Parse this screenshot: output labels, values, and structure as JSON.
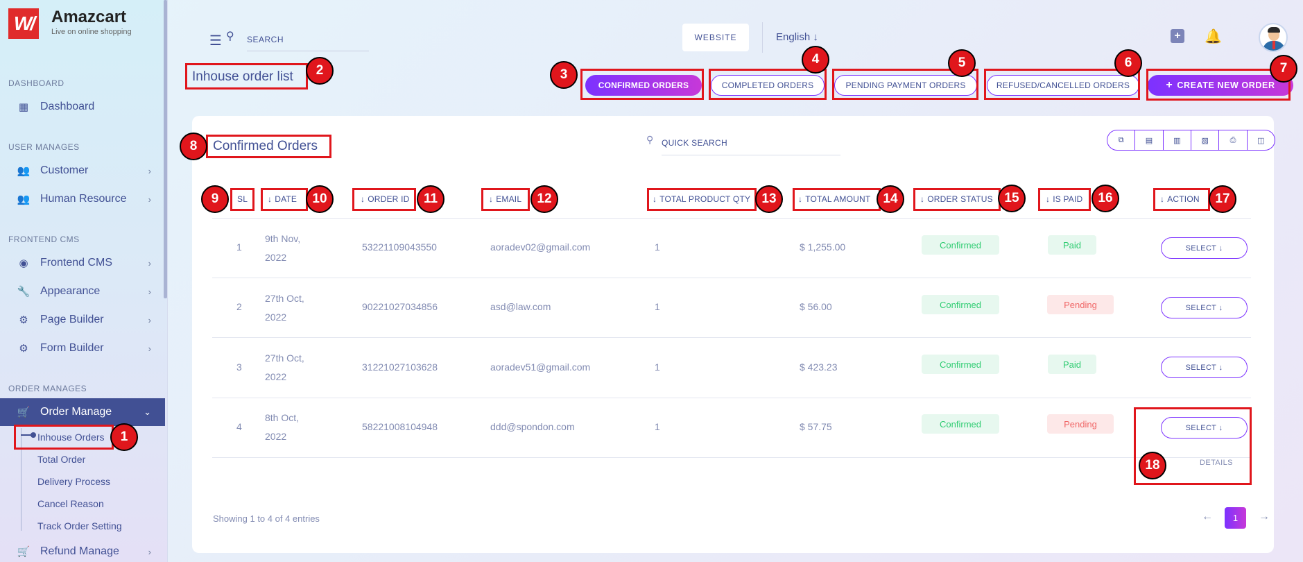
{
  "app": {
    "brand_name": "Amazcart",
    "brand_tagline": "Live on online shopping",
    "logo_text": "W/"
  },
  "sidebar": {
    "sections": [
      "DASHBOARD",
      "USER MANAGES",
      "FRONTEND CMS",
      "ORDER MANAGES"
    ],
    "items": [
      {
        "label": "Dashboard",
        "icon": "grid-icon"
      },
      {
        "label": "Customer",
        "icon": "users-icon"
      },
      {
        "label": "Human Resource",
        "icon": "users-icon"
      },
      {
        "label": "Frontend CMS",
        "icon": "eye-icon"
      },
      {
        "label": "Appearance",
        "icon": "wrench-icon"
      },
      {
        "label": "Page Builder",
        "icon": "gears-icon"
      },
      {
        "label": "Form Builder",
        "icon": "gears-icon"
      },
      {
        "label": "Order Manage",
        "icon": "cart-icon"
      },
      {
        "label": "Refund Manage",
        "icon": "cart-icon"
      }
    ],
    "sub_items": [
      "Inhouse Orders",
      "Total Order",
      "Delivery Process",
      "Cancel Reason",
      "Track Order Setting"
    ]
  },
  "topbar": {
    "search_placeholder": "SEARCH",
    "website_label": "WEBSITE",
    "language": "English"
  },
  "page": {
    "title": "Inhouse order list",
    "tabs": [
      "CONFIRMED ORDERS",
      "COMPLETED ORDERS",
      "PENDING PAYMENT ORDERS",
      "REFUSED/CANCELLED ORDERS"
    ],
    "create_label": "CREATE NEW ORDER"
  },
  "card": {
    "title": "Confirmed Orders",
    "quick_search_placeholder": "QUICK SEARCH",
    "export_icons": [
      "copy-icon",
      "excel-icon",
      "csv-icon",
      "pdf-icon",
      "print-icon",
      "columns-icon"
    ]
  },
  "table": {
    "headers": [
      "SL",
      "DATE",
      "ORDER ID",
      "EMAIL",
      "TOTAL PRODUCT QTY",
      "TOTAL AMOUNT",
      "ORDER STATUS",
      "IS PAID",
      "ACTION"
    ],
    "rows": [
      {
        "sl": "1",
        "date1": "9th Nov,",
        "date2": "2022",
        "order_id": "53221109043550",
        "email": "aoradev02@gmail.com",
        "qty": "1",
        "amount": "$ 1,255.00",
        "status": "Confirmed",
        "paid": "Paid",
        "action": "SELECT"
      },
      {
        "sl": "2",
        "date1": "27th Oct,",
        "date2": "2022",
        "order_id": "90221027034856",
        "email": "asd@law.com",
        "qty": "1",
        "amount": "$ 56.00",
        "status": "Confirmed",
        "paid": "Pending",
        "action": "SELECT"
      },
      {
        "sl": "3",
        "date1": "27th Oct,",
        "date2": "2022",
        "order_id": "31221027103628",
        "email": "aoradev51@gmail.com",
        "qty": "1",
        "amount": "$ 423.23",
        "status": "Confirmed",
        "paid": "Paid",
        "action": "SELECT"
      },
      {
        "sl": "4",
        "date1": "8th Oct,",
        "date2": "2022",
        "order_id": "58221008104948",
        "email": "ddd@spondon.com",
        "qty": "1",
        "amount": "$ 57.75",
        "status": "Confirmed",
        "paid": "Pending",
        "action": "SELECT"
      }
    ],
    "dropdown_item": "DETAILS"
  },
  "footer": {
    "showing": "Showing 1 to 4 of 4 entries",
    "current_page": "1"
  },
  "annotations": [
    "1",
    "2",
    "3",
    "4",
    "5",
    "6",
    "7",
    "8",
    "9",
    "10",
    "11",
    "12",
    "13",
    "14",
    "15",
    "16",
    "17",
    "18"
  ],
  "colors": {
    "primary": "#415094",
    "accent_start": "#7c32ff",
    "accent_end": "#c738d8",
    "annotation": "#e0161c"
  }
}
